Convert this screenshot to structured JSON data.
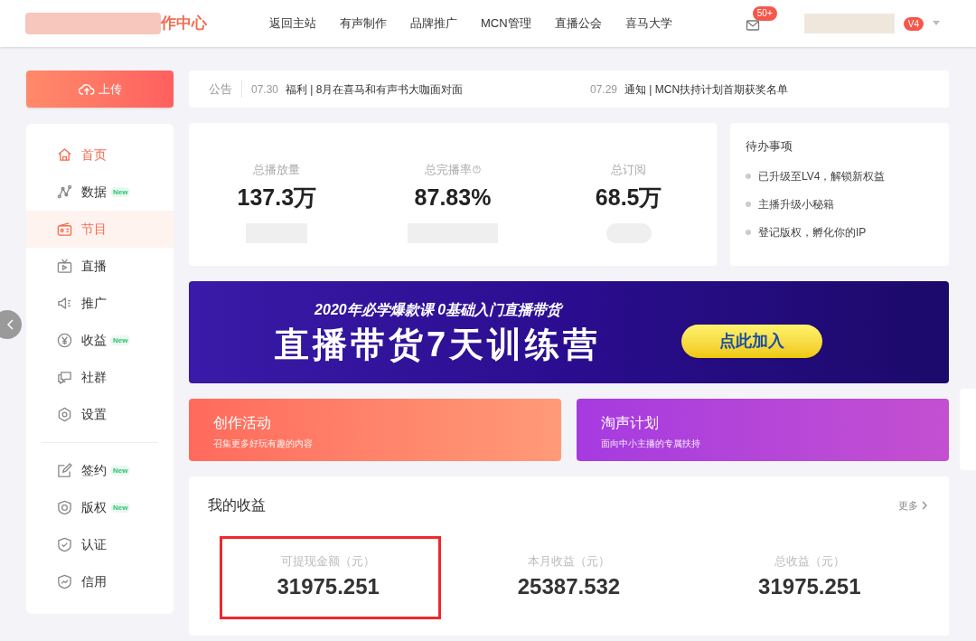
{
  "header": {
    "logo_text": "作中心",
    "nav": [
      "返回主站",
      "有声制作",
      "品牌推广",
      "MCN管理",
      "直播公会",
      "喜马大学"
    ],
    "mail_badge": "50+",
    "level_badge": "V4"
  },
  "upload_button": "上传",
  "notice": {
    "label": "公告",
    "items": [
      {
        "date": "07.30",
        "text": "福利 | 8月在喜马和有声书大咖面对面"
      },
      {
        "date": "07.29",
        "text": "通知 | MCN扶持计划首期获奖名单"
      }
    ]
  },
  "sidebar": {
    "groups": [
      [
        {
          "label": "首页",
          "current": true,
          "selected": false
        },
        {
          "label": "数据",
          "current": false,
          "selected": false,
          "tag": "New"
        },
        {
          "label": "节目",
          "current": false,
          "selected": true
        },
        {
          "label": "直播",
          "current": false,
          "selected": false
        },
        {
          "label": "推广",
          "current": false,
          "selected": false
        },
        {
          "label": "收益",
          "current": false,
          "selected": false,
          "tag": "New"
        },
        {
          "label": "社群",
          "current": false,
          "selected": false
        },
        {
          "label": "设置",
          "current": false,
          "selected": false
        }
      ],
      [
        {
          "label": "签约",
          "current": false,
          "selected": false,
          "tag": "New"
        },
        {
          "label": "版权",
          "current": false,
          "selected": false,
          "tag": "New"
        },
        {
          "label": "认证",
          "current": false,
          "selected": false
        },
        {
          "label": "信用",
          "current": false,
          "selected": false
        }
      ]
    ]
  },
  "stats": [
    {
      "label": "总播放量",
      "value": "137.3万",
      "help": false
    },
    {
      "label": "总完播率",
      "value": "87.83%",
      "help": true
    },
    {
      "label": "总订阅",
      "value": "68.5万",
      "help": false
    }
  ],
  "todo": {
    "title": "待办事项",
    "items": [
      "已升级至LV4，解锁新权益",
      "主播升级小秘籍",
      "登记版权，孵化你的IP"
    ]
  },
  "banner": {
    "subtitle": "2020年必学爆款课 0基础入门直播带货",
    "title": "直播带货7天训练营",
    "button": "点此加入"
  },
  "promo_cards": [
    {
      "title": "创作活动",
      "subtitle": "召集更多好玩有趣的内容",
      "kind": "orange"
    },
    {
      "title": "淘声计划",
      "subtitle": "面向中小主播的专属扶持",
      "kind": "purple"
    }
  ],
  "income": {
    "title": "我的收益",
    "more": "更多",
    "items": [
      {
        "label": "可提现金额（元）",
        "value": "31975.251",
        "highlighted": true
      },
      {
        "label": "本月收益（元）",
        "value": "25387.532",
        "highlighted": false
      },
      {
        "label": "总收益（元）",
        "value": "31975.251",
        "highlighted": false
      }
    ]
  }
}
